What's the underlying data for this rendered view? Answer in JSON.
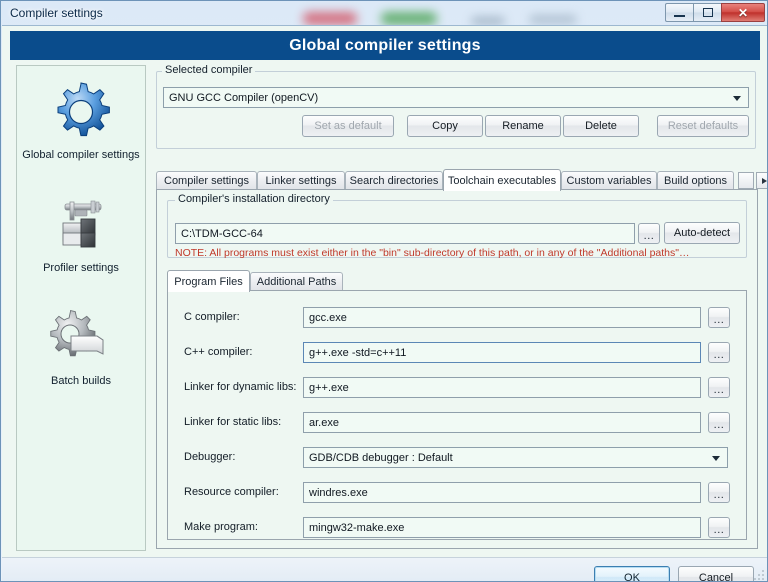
{
  "window": {
    "title": "Compiler settings",
    "controls": {
      "minimize": "minimize-icon",
      "maximize": "maximize-icon",
      "close": "✕"
    }
  },
  "banner": {
    "title": "Global compiler settings"
  },
  "sidebar": {
    "items": [
      {
        "label": "Global compiler settings",
        "icon": "blue-gear-icon",
        "selected": true
      },
      {
        "label": "Profiler settings",
        "icon": "caliper-blocks-icon",
        "selected": false
      },
      {
        "label": "Batch builds",
        "icon": "gear-documents-icon",
        "selected": false
      }
    ]
  },
  "compiler_group": {
    "label": "Selected compiler",
    "selected_compiler": "GNU GCC Compiler (openCV)",
    "buttons": [
      {
        "label": "Set as default",
        "disabled": true
      },
      {
        "label": "Copy",
        "disabled": false
      },
      {
        "label": "Rename",
        "disabled": false
      },
      {
        "label": "Delete",
        "disabled": false
      },
      {
        "label": "Reset defaults",
        "disabled": true
      }
    ]
  },
  "tabs": {
    "items": [
      {
        "label": "Compiler settings",
        "active": false
      },
      {
        "label": "Linker settings",
        "active": false
      },
      {
        "label": "Search directories",
        "active": false
      },
      {
        "label": "Toolchain executables",
        "active": true
      },
      {
        "label": "Custom variables",
        "active": false
      },
      {
        "label": "Build options",
        "active": false
      }
    ],
    "scroll_left": "◀",
    "scroll_right": "▶"
  },
  "install_group": {
    "label": "Compiler's installation directory",
    "path_value": "C:\\TDM-GCC-64",
    "browse_label": "...",
    "autodetect_label": "Auto-detect",
    "note": "NOTE: All programs must exist either in the \"bin\" sub-directory of this path, or in any of the \"Additional paths\"…"
  },
  "inner_tabs": {
    "items": [
      {
        "label": "Program Files",
        "active": true
      },
      {
        "label": "Additional Paths",
        "active": false
      }
    ]
  },
  "program_files": {
    "browse_label": "...",
    "fields": [
      {
        "label": "C compiler:",
        "value": "gcc.exe",
        "type": "text",
        "focused": false
      },
      {
        "label": "C++ compiler:",
        "value": "g++.exe -std=c++11",
        "type": "text",
        "focused": true
      },
      {
        "label": "Linker for dynamic libs:",
        "value": "g++.exe",
        "type": "text",
        "focused": false
      },
      {
        "label": "Linker for static libs:",
        "value": "ar.exe",
        "type": "text",
        "focused": false
      },
      {
        "label": "Debugger:",
        "value": "GDB/CDB debugger : Default",
        "type": "combo",
        "focused": false
      },
      {
        "label": "Resource compiler:",
        "value": "windres.exe",
        "type": "text",
        "focused": false
      },
      {
        "label": "Make program:",
        "value": "mingw32-make.exe",
        "type": "text",
        "focused": false
      }
    ]
  },
  "footer": {
    "ok_label": "OK",
    "cancel_label": "Cancel"
  },
  "colors": {
    "banner_blue": "#0a4c8c",
    "window_bg": "#eef7f2",
    "note_red": "#c0392b",
    "field_bg": "#f1faf5",
    "close_red": "#bf312c"
  }
}
